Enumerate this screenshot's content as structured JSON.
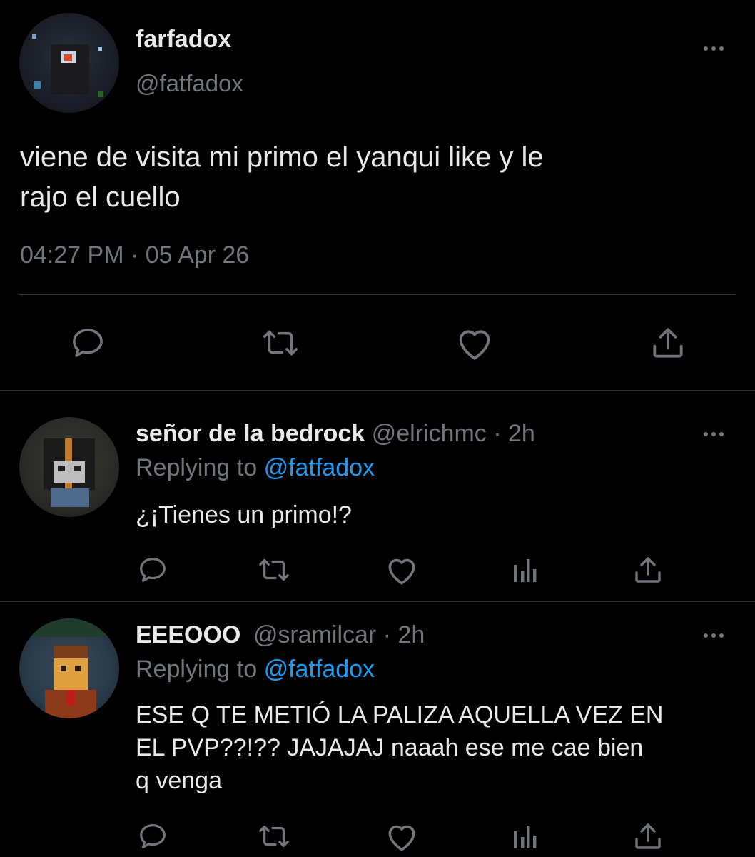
{
  "main_tweet": {
    "display_name": "farfadox",
    "handle": "@fatfadox",
    "text_line1": "viene de visita mi primo el yanqui like y le",
    "text_line2": "rajo el cuello",
    "timestamp": "04:27 PM · 05 Apr 26"
  },
  "replies": [
    {
      "display_name": "señor de la bedrock",
      "handle": "@elrichmc",
      "time": "· 2h",
      "replying_label": "Replying to",
      "replying_to": "@fatfadox",
      "text_lines": [
        "¿¡Tienes un primo!?"
      ]
    },
    {
      "display_name": "EEEOOO",
      "handle": "@sramilcar",
      "time": "· 2h",
      "replying_label": "Replying to",
      "replying_to": "@fatfadox",
      "text_lines": [
        "ESE Q TE METIÓ LA PALIZA AQUELLA VEZ EN",
        "EL PVP??!?? JAJAJAJ naaah ese me cae bien",
        "q venga"
      ]
    }
  ],
  "icons": [
    "reply-icon",
    "retweet-icon",
    "like-icon",
    "analytics-icon",
    "share-icon",
    "more-icon"
  ],
  "colors": {
    "background": "#000000",
    "text": "#e7e9ea",
    "muted": "#71767b",
    "link": "#1d9bf0",
    "divider": "#2f3336"
  }
}
